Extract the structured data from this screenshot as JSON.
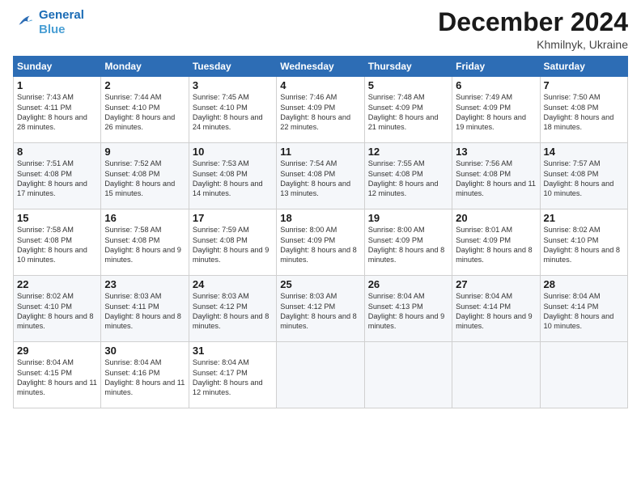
{
  "logo": {
    "line1": "General",
    "line2": "Blue"
  },
  "title": "December 2024",
  "subtitle": "Khmilnyk, Ukraine",
  "headers": [
    "Sunday",
    "Monday",
    "Tuesday",
    "Wednesday",
    "Thursday",
    "Friday",
    "Saturday"
  ],
  "weeks": [
    [
      {
        "day": "1",
        "sunrise": "7:43 AM",
        "sunset": "4:11 PM",
        "daylight": "8 hours and 28 minutes."
      },
      {
        "day": "2",
        "sunrise": "7:44 AM",
        "sunset": "4:10 PM",
        "daylight": "8 hours and 26 minutes."
      },
      {
        "day": "3",
        "sunrise": "7:45 AM",
        "sunset": "4:10 PM",
        "daylight": "8 hours and 24 minutes."
      },
      {
        "day": "4",
        "sunrise": "7:46 AM",
        "sunset": "4:09 PM",
        "daylight": "8 hours and 22 minutes."
      },
      {
        "day": "5",
        "sunrise": "7:48 AM",
        "sunset": "4:09 PM",
        "daylight": "8 hours and 21 minutes."
      },
      {
        "day": "6",
        "sunrise": "7:49 AM",
        "sunset": "4:09 PM",
        "daylight": "8 hours and 19 minutes."
      },
      {
        "day": "7",
        "sunrise": "7:50 AM",
        "sunset": "4:08 PM",
        "daylight": "8 hours and 18 minutes."
      }
    ],
    [
      {
        "day": "8",
        "sunrise": "7:51 AM",
        "sunset": "4:08 PM",
        "daylight": "8 hours and 17 minutes."
      },
      {
        "day": "9",
        "sunrise": "7:52 AM",
        "sunset": "4:08 PM",
        "daylight": "8 hours and 15 minutes."
      },
      {
        "day": "10",
        "sunrise": "7:53 AM",
        "sunset": "4:08 PM",
        "daylight": "8 hours and 14 minutes."
      },
      {
        "day": "11",
        "sunrise": "7:54 AM",
        "sunset": "4:08 PM",
        "daylight": "8 hours and 13 minutes."
      },
      {
        "day": "12",
        "sunrise": "7:55 AM",
        "sunset": "4:08 PM",
        "daylight": "8 hours and 12 minutes."
      },
      {
        "day": "13",
        "sunrise": "7:56 AM",
        "sunset": "4:08 PM",
        "daylight": "8 hours and 11 minutes."
      },
      {
        "day": "14",
        "sunrise": "7:57 AM",
        "sunset": "4:08 PM",
        "daylight": "8 hours and 10 minutes."
      }
    ],
    [
      {
        "day": "15",
        "sunrise": "7:58 AM",
        "sunset": "4:08 PM",
        "daylight": "8 hours and 10 minutes."
      },
      {
        "day": "16",
        "sunrise": "7:58 AM",
        "sunset": "4:08 PM",
        "daylight": "8 hours and 9 minutes."
      },
      {
        "day": "17",
        "sunrise": "7:59 AM",
        "sunset": "4:08 PM",
        "daylight": "8 hours and 9 minutes."
      },
      {
        "day": "18",
        "sunrise": "8:00 AM",
        "sunset": "4:09 PM",
        "daylight": "8 hours and 8 minutes."
      },
      {
        "day": "19",
        "sunrise": "8:00 AM",
        "sunset": "4:09 PM",
        "daylight": "8 hours and 8 minutes."
      },
      {
        "day": "20",
        "sunrise": "8:01 AM",
        "sunset": "4:09 PM",
        "daylight": "8 hours and 8 minutes."
      },
      {
        "day": "21",
        "sunrise": "8:02 AM",
        "sunset": "4:10 PM",
        "daylight": "8 hours and 8 minutes."
      }
    ],
    [
      {
        "day": "22",
        "sunrise": "8:02 AM",
        "sunset": "4:10 PM",
        "daylight": "8 hours and 8 minutes."
      },
      {
        "day": "23",
        "sunrise": "8:03 AM",
        "sunset": "4:11 PM",
        "daylight": "8 hours and 8 minutes."
      },
      {
        "day": "24",
        "sunrise": "8:03 AM",
        "sunset": "4:12 PM",
        "daylight": "8 hours and 8 minutes."
      },
      {
        "day": "25",
        "sunrise": "8:03 AM",
        "sunset": "4:12 PM",
        "daylight": "8 hours and 8 minutes."
      },
      {
        "day": "26",
        "sunrise": "8:04 AM",
        "sunset": "4:13 PM",
        "daylight": "8 hours and 9 minutes."
      },
      {
        "day": "27",
        "sunrise": "8:04 AM",
        "sunset": "4:14 PM",
        "daylight": "8 hours and 9 minutes."
      },
      {
        "day": "28",
        "sunrise": "8:04 AM",
        "sunset": "4:14 PM",
        "daylight": "8 hours and 10 minutes."
      }
    ],
    [
      {
        "day": "29",
        "sunrise": "8:04 AM",
        "sunset": "4:15 PM",
        "daylight": "8 hours and 11 minutes."
      },
      {
        "day": "30",
        "sunrise": "8:04 AM",
        "sunset": "4:16 PM",
        "daylight": "8 hours and 11 minutes."
      },
      {
        "day": "31",
        "sunrise": "8:04 AM",
        "sunset": "4:17 PM",
        "daylight": "8 hours and 12 minutes."
      },
      null,
      null,
      null,
      null
    ]
  ]
}
